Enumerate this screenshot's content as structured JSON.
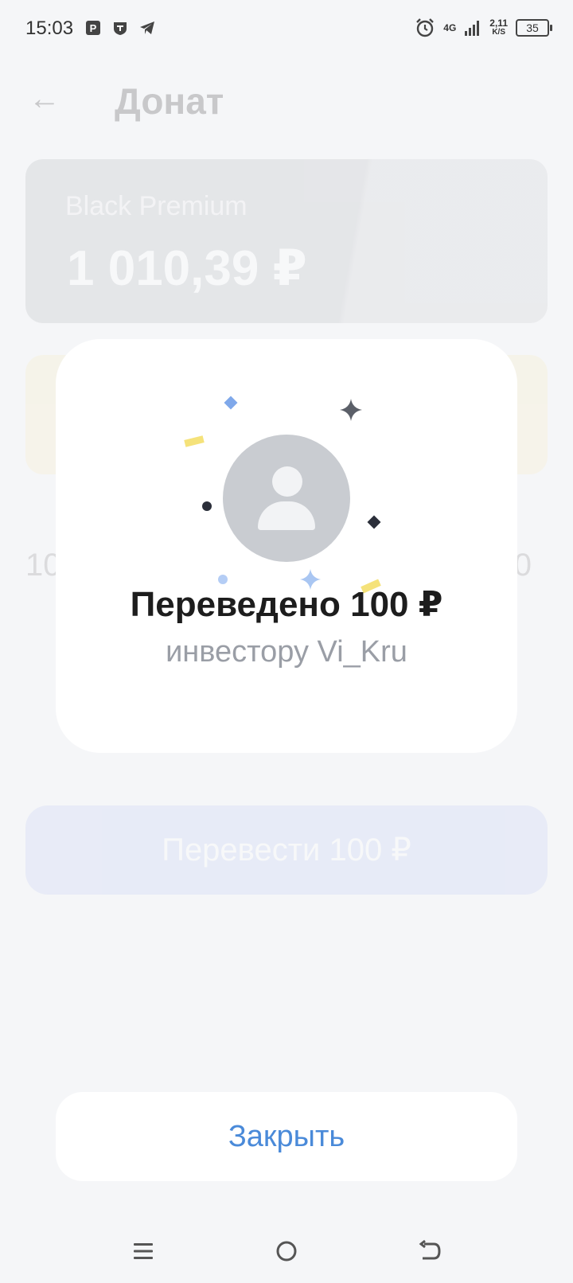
{
  "status_bar": {
    "time": "15:03",
    "network": "4G",
    "speed_value": "2,11",
    "speed_unit": "K/S",
    "battery": "35",
    "left_icons": [
      "parking-app-icon",
      "shield-app-icon",
      "telegram-icon"
    ]
  },
  "background": {
    "title": "Донат",
    "card_name": "Black Premium",
    "card_balance": "1 010,39 ₽",
    "amount_left": "10",
    "amount_right": "0",
    "transfer_button_label": "Перевести 100 ₽"
  },
  "dialog": {
    "title": "Переведено 100 ₽",
    "subtitle": "инвестору Vi_Kru"
  },
  "close_button_label": "Закрыть",
  "colors": {
    "accent_text": "#4a8ad9",
    "dialog_bg": "#ffffff",
    "page_bg": "#f5f6f8"
  }
}
